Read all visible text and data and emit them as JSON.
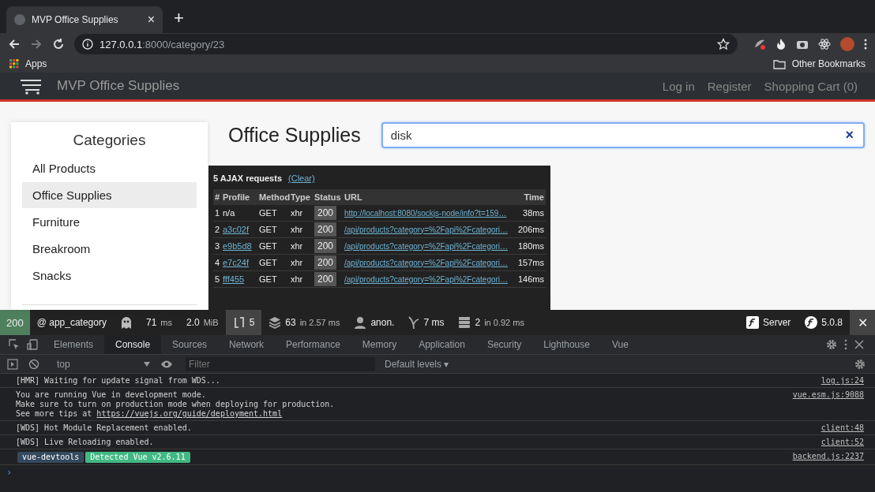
{
  "browser": {
    "tab_title": "MVP Office Supplies",
    "close": "×",
    "new_tab": "+",
    "url_host": "127.0.0.1",
    "url_rest": ":8000/category/23",
    "bookmarks": [
      "Apps"
    ],
    "other_bookmarks": "Other Bookmarks"
  },
  "site": {
    "brand": "MVP Office Supplies",
    "nav": [
      "Log in",
      "Register",
      "Shopping Cart (0)"
    ]
  },
  "sidebar": {
    "title": "Categories",
    "items": [
      {
        "label": "All Products",
        "selected": false
      },
      {
        "label": "Office Supplies",
        "selected": true
      },
      {
        "label": "Furniture",
        "selected": false
      },
      {
        "label": "Breakroom",
        "selected": false
      },
      {
        "label": "Snacks",
        "selected": false
      }
    ]
  },
  "heading": "Office Supplies",
  "search": {
    "value": "disk",
    "clear": "×"
  },
  "ajax": {
    "title": "5 AJAX requests",
    "clear": "(Clear)",
    "columns": [
      "#",
      "Profile",
      "Method",
      "Type",
      "Status",
      "URL",
      "Time"
    ],
    "rows": [
      {
        "num": "1",
        "profile": "n/a",
        "linked": false,
        "method": "GET",
        "type": "xhr",
        "status": "200",
        "url": "http://localhost:8080/sockjs-node/info?t=159…",
        "time": "38ms"
      },
      {
        "num": "2",
        "profile": "a3c02f",
        "linked": true,
        "method": "GET",
        "type": "xhr",
        "status": "200",
        "url": "/api/products?category=%2Fapi%2Fcategori…",
        "time": "206ms"
      },
      {
        "num": "3",
        "profile": "e9b5d8",
        "linked": true,
        "method": "GET",
        "type": "xhr",
        "status": "200",
        "url": "/api/products?category=%2Fapi%2Fcategori…",
        "time": "180ms"
      },
      {
        "num": "4",
        "profile": "e7c24f",
        "linked": true,
        "method": "GET",
        "type": "xhr",
        "status": "200",
        "url": "/api/products?category=%2Fapi%2Fcategori…",
        "time": "157ms"
      },
      {
        "num": "5",
        "profile": "fff455",
        "linked": true,
        "method": "GET",
        "type": "xhr",
        "status": "200",
        "url": "/api/products?category=%2Fapi%2Fcategori…",
        "time": "146ms"
      }
    ]
  },
  "toolbar": {
    "status": "200",
    "route": "@ app_category",
    "time": "71",
    "time_unit": "ms",
    "memory": "2.0",
    "memory_unit": "MiB",
    "ajax_count": "5",
    "db": "63",
    "db_in": "in 2.57 ms",
    "user": "anon.",
    "twig": "7 ms",
    "cache": "2",
    "cache_in": "in 0.92 ms",
    "server": "Server",
    "version": "5.0.8",
    "close": "✕"
  },
  "devtools": {
    "tabs": [
      {
        "label": "Elements",
        "selected": false
      },
      {
        "label": "Console",
        "selected": true
      },
      {
        "label": "Sources",
        "selected": false
      },
      {
        "label": "Network",
        "selected": false
      },
      {
        "label": "Performance",
        "selected": false
      },
      {
        "label": "Memory",
        "selected": false
      },
      {
        "label": "Application",
        "selected": false
      },
      {
        "label": "Security",
        "selected": false
      },
      {
        "label": "Lighthouse",
        "selected": false
      },
      {
        "label": "Vue",
        "selected": false
      }
    ],
    "context": "top",
    "filter_placeholder": "Filter",
    "levels": "Default levels ▾",
    "prompt": "›",
    "messages": [
      {
        "kind": "text",
        "lines": [
          "[HMR] Waiting for update signal from WDS..."
        ],
        "source": "log.js:24"
      },
      {
        "kind": "link",
        "lines": [
          "You are running Vue in development mode.",
          "Make sure to turn on production mode when deploying for production."
        ],
        "prefix": "See more tips at ",
        "link": "https://vuejs.org/guide/deployment.html",
        "source": "vue.esm.js:9088"
      },
      {
        "kind": "text",
        "lines": [
          "[WDS] Hot Module Replacement enabled."
        ],
        "source": "client:48"
      },
      {
        "kind": "text",
        "lines": [
          "[WDS] Live Reloading enabled."
        ],
        "source": "client:52"
      },
      {
        "kind": "badges",
        "badges": [
          "vue-devtools",
          "Detected Vue v2.6.11"
        ],
        "source": "backend.js:2237"
      }
    ]
  }
}
